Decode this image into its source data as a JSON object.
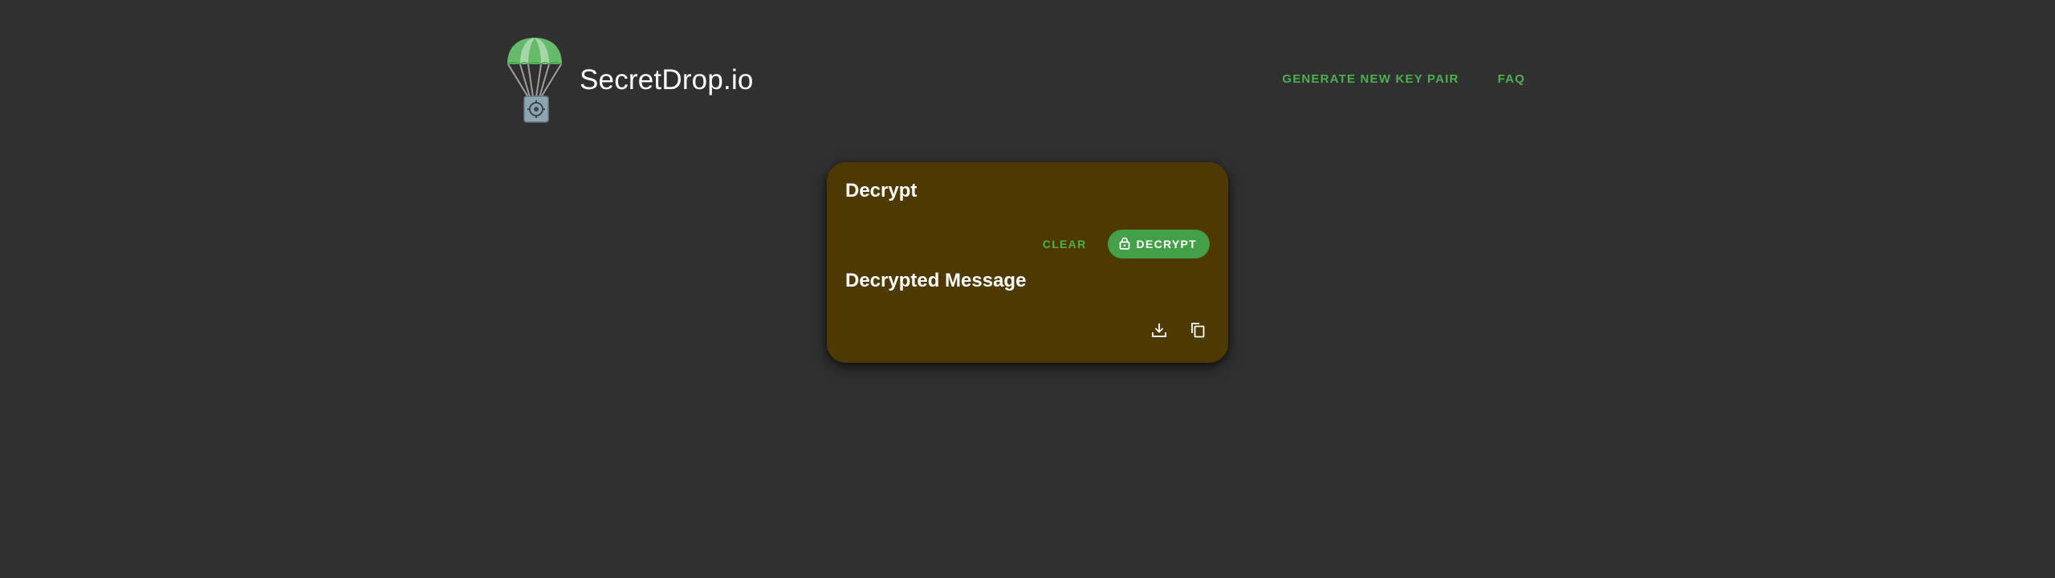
{
  "header": {
    "brand": "SecretDrop.io",
    "nav": {
      "generate_label": "GENERATE NEW KEY PAIR",
      "faq_label": "FAQ"
    }
  },
  "card": {
    "title": "Decrypt",
    "clear_label": "CLEAR",
    "decrypt_label": "DECRYPT",
    "result_title": "Decrypted Message",
    "icons": [
      "download-icon",
      "copy-icon"
    ]
  },
  "colors": {
    "background": "#303030",
    "card": "#4e3a00",
    "accent": "#4caf50",
    "button": "#43a047"
  }
}
